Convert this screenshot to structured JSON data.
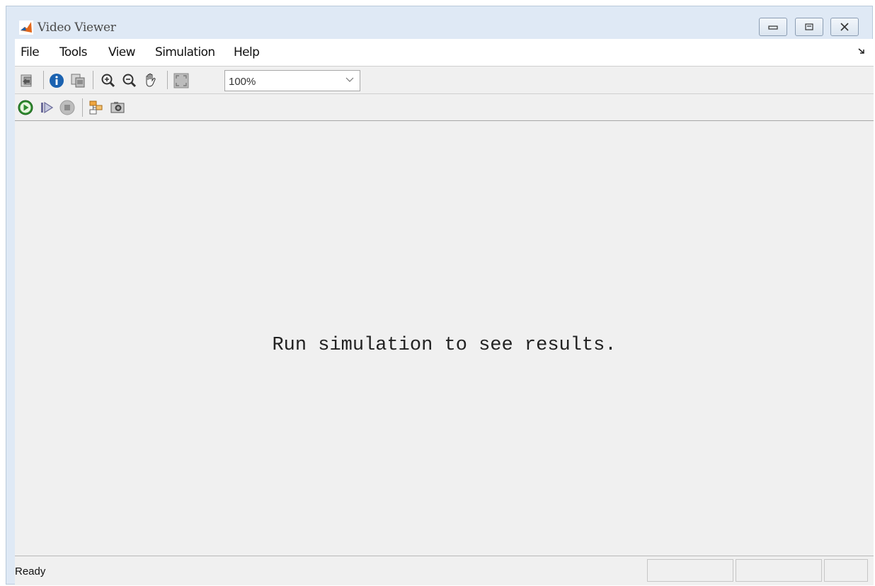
{
  "window": {
    "title": "Video Viewer"
  },
  "menu": [
    {
      "label": "File"
    },
    {
      "label": "Tools"
    },
    {
      "label": "View"
    },
    {
      "label": "Simulation"
    },
    {
      "label": "Help"
    }
  ],
  "toolbar": {
    "zoom_value": "100%",
    "icons": [
      "print-icon",
      "info-icon",
      "export-icon",
      "zoom-in-icon",
      "zoom-out-icon",
      "pan-hand-icon",
      "fit-to-view-icon",
      "run-icon",
      "step-forward-icon",
      "stop-icon",
      "highlight-block-icon",
      "snapshot-icon"
    ]
  },
  "content": {
    "message": "Run simulation to see results."
  },
  "status": {
    "text": "Ready"
  },
  "colors": {
    "accent_run": "#2e8b2e",
    "titlebar": "#dfe9f5",
    "panel": "#f0f0f0"
  }
}
